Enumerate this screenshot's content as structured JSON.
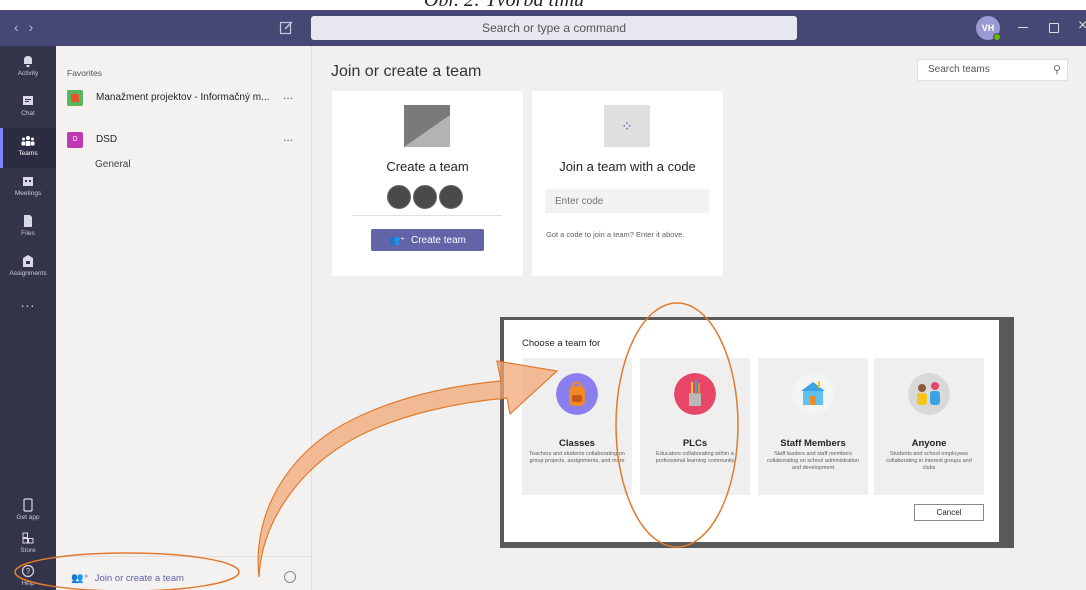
{
  "caption": "Obr. 2: Tvorba tímu",
  "titlebar": {
    "search_placeholder": "Search or type a command",
    "avatar_initials": "VH",
    "icons": [
      "back-icon",
      "forward-icon",
      "compose-icon",
      "minimize-icon",
      "maximize-icon",
      "close-icon"
    ]
  },
  "rail": {
    "items": [
      {
        "label": "Activity",
        "icon": "bell-icon"
      },
      {
        "label": "Chat",
        "icon": "chat-icon"
      },
      {
        "label": "Teams",
        "icon": "teams-icon"
      },
      {
        "label": "Meetings",
        "icon": "calendar-icon"
      },
      {
        "label": "Files",
        "icon": "file-icon"
      },
      {
        "label": "Assignments",
        "icon": "assignments-icon"
      },
      {
        "label": "Get app",
        "icon": "device-icon"
      },
      {
        "label": "Store",
        "icon": "store-icon"
      },
      {
        "label": "Help",
        "icon": "help-icon"
      }
    ],
    "more_label": "...",
    "active": "Teams"
  },
  "panel": {
    "favorites_label": "Favorites",
    "teams": [
      {
        "name": "Manažment projektov - Informačný m...",
        "more": "...",
        "color": "#e3572c"
      },
      {
        "name": "DSD",
        "more": "...",
        "color": "#c239b3",
        "badge": "D"
      }
    ],
    "channel": "General",
    "join_label": "Join or create a team"
  },
  "main": {
    "title": "Join or create a team",
    "search_placeholder": "Search teams",
    "create_card": {
      "title": "Create a team",
      "button": "Create team"
    },
    "join_card": {
      "title": "Join a team with a code",
      "code_placeholder": "Enter code",
      "help": "Got a code to join a team? Enter it above."
    }
  },
  "dialog": {
    "title": "Choose a team for",
    "categories": [
      {
        "name": "Classes",
        "description": "Teachers and students collaborating on group projects, assignments, and more",
        "color": "#8b7ff0",
        "icon": "backpack-icon"
      },
      {
        "name": "PLCs",
        "description": "Educators collaborating within a professional learning community",
        "color": "#e8476a",
        "icon": "pencil-cup-icon"
      },
      {
        "name": "Staff Members",
        "description": "Staff leaders and staff members collaborating on school administration and development",
        "color": "#f4f4f4",
        "icon": "school-building-icon"
      },
      {
        "name": "Anyone",
        "description": "Students and school employees collaborating in interest groups and clubs",
        "color": "#d9d9d9",
        "icon": "group-people-icon"
      }
    ],
    "cancel_label": "Cancel"
  },
  "colors": {
    "brand": "#6264a7",
    "titlebar": "#464775",
    "rail": "#33344a",
    "annotation": "#e07b2e"
  }
}
